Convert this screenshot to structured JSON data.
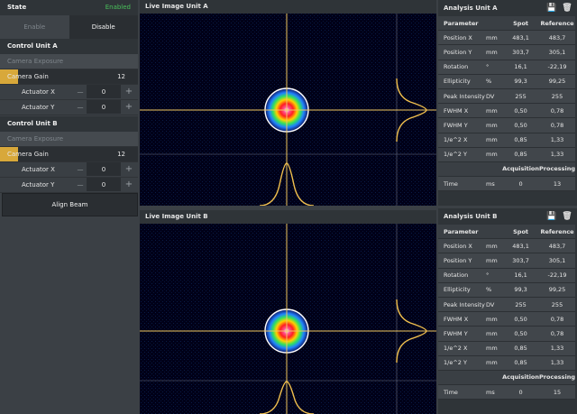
{
  "state": {
    "label": "State",
    "value": "Enabled",
    "enable_label": "Enable",
    "disable_label": "Disable"
  },
  "control_a": {
    "title": "Control Unit A",
    "exposure_label": "Camera Exposure",
    "gain_label": "Camera Gain",
    "gain_value": "12",
    "gain_level": 0.13,
    "actuators": [
      {
        "label": "Actuator X",
        "value": "0"
      },
      {
        "label": "Actuator Y",
        "value": "0"
      }
    ]
  },
  "control_b": {
    "title": "Control Unit B",
    "exposure_label": "Camera Exposure",
    "gain_label": "Camera Gain",
    "gain_value": "12",
    "gain_level": 0.13,
    "actuators": [
      {
        "label": "Actuator X",
        "value": "0"
      },
      {
        "label": "Actuator Y",
        "value": "0"
      }
    ]
  },
  "align_label": "Align Beam",
  "actuator_minus": "—",
  "actuator_plus": "+",
  "live_a": {
    "title": "Live Image Unit A"
  },
  "live_b": {
    "title": "Live Image Unit B"
  },
  "colors": {
    "accent": "#d8a83a",
    "enabled": "#49c05a",
    "profile": "#f2c14e",
    "crosshair": "#f0c860"
  },
  "analysis_a": {
    "title": "Analysis Unit A",
    "save_icon": "save-icon",
    "delete_icon": "trash-icon",
    "head": [
      "Parameter",
      "",
      "Spot",
      "Reference"
    ],
    "rows": [
      [
        "Position X",
        "mm",
        "483,1",
        "483,7"
      ],
      [
        "Position Y",
        "mm",
        "303,7",
        "305,1"
      ],
      [
        "Rotation",
        "°",
        "16,1",
        "-22,19"
      ],
      [
        "Ellipticity",
        "%",
        "99,3",
        "99,25"
      ],
      [
        "Peak Intensity",
        "DV",
        "255",
        "255"
      ],
      [
        "FWHM X",
        "mm",
        "0,50",
        "0,78"
      ],
      [
        "FWHM Y",
        "mm",
        "0,50",
        "0,78"
      ],
      [
        "1/e^2 X",
        "mm",
        "0,85",
        "1,33"
      ],
      [
        "1/e^2 Y",
        "mm",
        "0,85",
        "1,33"
      ]
    ],
    "time_head": [
      "",
      "",
      "Acquisition",
      "Processing"
    ],
    "time_row": [
      "Time",
      "ms",
      "0",
      "13"
    ]
  },
  "analysis_b": {
    "title": "Analysis Unit B",
    "save_icon": "save-icon",
    "delete_icon": "trash-icon",
    "head": [
      "Parameter",
      "",
      "Spot",
      "Reference"
    ],
    "rows": [
      [
        "Position X",
        "mm",
        "483,1",
        "483,7"
      ],
      [
        "Position Y",
        "mm",
        "303,7",
        "305,1"
      ],
      [
        "Rotation",
        "°",
        "16,1",
        "-22,19"
      ],
      [
        "Ellipticity",
        "%",
        "99,3",
        "99,25"
      ],
      [
        "Peak Intensity",
        "DV",
        "255",
        "255"
      ],
      [
        "FWHM X",
        "mm",
        "0,50",
        "0,78"
      ],
      [
        "FWHM Y",
        "mm",
        "0,50",
        "0,78"
      ],
      [
        "1/e^2 X",
        "mm",
        "0,85",
        "1,33"
      ],
      [
        "1/e^2 Y",
        "mm",
        "0,85",
        "1,33"
      ]
    ],
    "time_head": [
      "",
      "",
      "Acquisition",
      "Processing"
    ],
    "time_row": [
      "Time",
      "ms",
      "0",
      "15"
    ]
  }
}
